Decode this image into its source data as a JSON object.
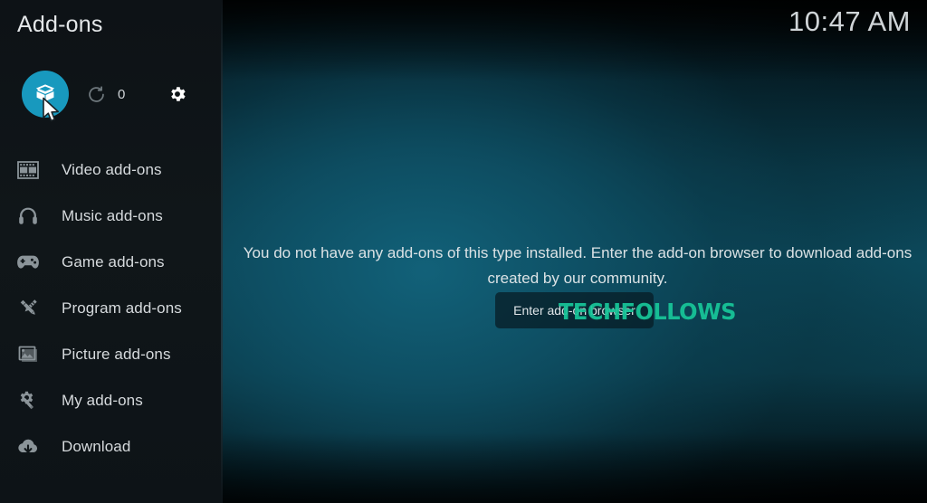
{
  "window": {
    "title": "Add-ons",
    "clock": "10:47 AM"
  },
  "toolbar": {
    "browser_button": {
      "label": "add-on-browser",
      "icon": "open-box-icon",
      "selected": true
    },
    "update_button": {
      "label": "check-for-updates",
      "icon": "refresh-icon"
    },
    "update_count": "0",
    "settings_button": {
      "label": "settings",
      "icon": "gear-icon"
    }
  },
  "sidebar": {
    "items": [
      {
        "label": "Video add-ons",
        "icon": "film-strip-icon"
      },
      {
        "label": "Music add-ons",
        "icon": "headphones-icon"
      },
      {
        "label": "Game add-ons",
        "icon": "gamepad-icon"
      },
      {
        "label": "Program add-ons",
        "icon": "pencil-ruler-icon"
      },
      {
        "label": "Picture add-ons",
        "icon": "photo-icon"
      },
      {
        "label": "My add-ons",
        "icon": "gear-wrench-icon"
      },
      {
        "label": "Download",
        "icon": "download-cloud-icon"
      }
    ]
  },
  "main": {
    "empty_message": "You do not have any add-ons of this type installed. Enter the add-on browser to download add-ons created by our community.",
    "enter_browser_label": "Enter add-on browser",
    "watermark": "TECHFOLLOWS"
  },
  "colors": {
    "accent": "#1899be",
    "watermark": "#18c79a",
    "sidebar_bg": "#101619",
    "content_teal": "#0d4d60",
    "text_primary": "#dbe2e5",
    "text_muted": "#9aa3a8"
  }
}
